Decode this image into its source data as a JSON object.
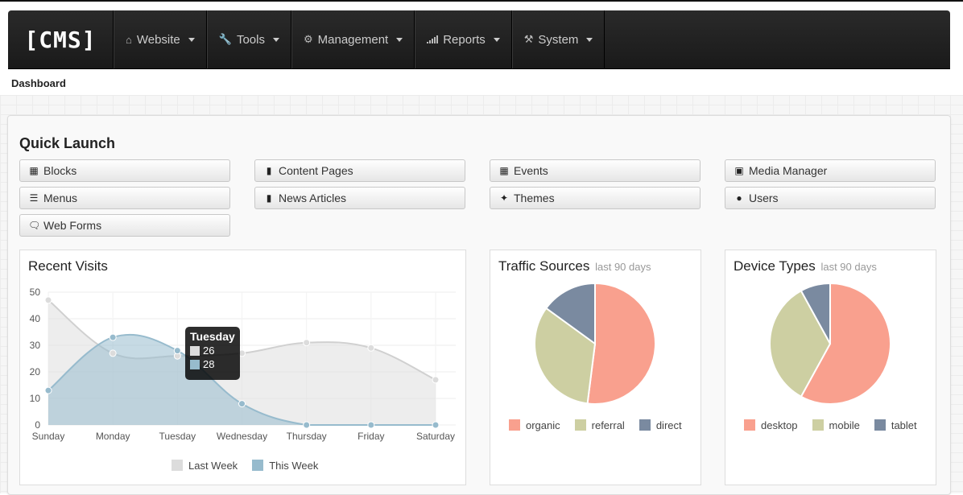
{
  "nav": {
    "brand": "[CMS]",
    "items": [
      {
        "label": "Website",
        "icon": "home-icon"
      },
      {
        "label": "Tools",
        "icon": "wrench-icon"
      },
      {
        "label": "Management",
        "icon": "cogs-icon"
      },
      {
        "label": "Reports",
        "icon": "signal-icon"
      },
      {
        "label": "System",
        "icon": "gavel-icon"
      }
    ]
  },
  "breadcrumb": "Dashboard",
  "quick_launch": {
    "title": "Quick Launch",
    "buttons": [
      {
        "label": "Blocks",
        "icon": "th-large-icon"
      },
      {
        "label": "Content Pages",
        "icon": "file-icon"
      },
      {
        "label": "Events",
        "icon": "calendar-icon"
      },
      {
        "label": "Media Manager",
        "icon": "picture-icon"
      },
      {
        "label": "Menus",
        "icon": "list-icon"
      },
      {
        "label": "News Articles",
        "icon": "book-icon"
      },
      {
        "label": "Themes",
        "icon": "magic-icon"
      },
      {
        "label": "Users",
        "icon": "user-icon"
      },
      {
        "label": "Web Forms",
        "icon": "comments-icon"
      }
    ]
  },
  "recent_visits": {
    "title": "Recent Visits",
    "tooltip": {
      "title": "Tuesday",
      "last_week": "26",
      "this_week": "28"
    }
  },
  "traffic_sources": {
    "title": "Traffic Sources",
    "subtitle": "last 90 days"
  },
  "device_types": {
    "title": "Device Types",
    "subtitle": "last 90 days"
  },
  "colors": {
    "last_week": "#dcdcdc",
    "this_week": "#97bbcd",
    "organic": "#f9a08e",
    "referral": "#cdcfa2",
    "direct": "#7a8aa0"
  },
  "chart_data": [
    {
      "type": "area",
      "title": "Recent Visits",
      "categories": [
        "Sunday",
        "Monday",
        "Tuesday",
        "Wednesday",
        "Thursday",
        "Friday",
        "Saturday"
      ],
      "series": [
        {
          "name": "Last Week",
          "values": [
            47,
            27,
            26,
            27,
            31,
            29,
            17
          ]
        },
        {
          "name": "This Week",
          "values": [
            13,
            33,
            28,
            8,
            0,
            0,
            0
          ]
        }
      ],
      "ylim": [
        0,
        50
      ],
      "yticks": [
        0,
        10,
        20,
        30,
        40,
        50
      ],
      "legend": "bottom"
    },
    {
      "type": "pie",
      "title": "Traffic Sources",
      "subtitle": "last 90 days",
      "slices": [
        {
          "name": "organic",
          "value": 52
        },
        {
          "name": "referral",
          "value": 33
        },
        {
          "name": "direct",
          "value": 15
        }
      ],
      "legend": "bottom"
    },
    {
      "type": "pie",
      "title": "Device Types",
      "subtitle": "last 90 days",
      "slices": [
        {
          "name": "desktop",
          "value": 58
        },
        {
          "name": "mobile",
          "value": 34
        },
        {
          "name": "tablet",
          "value": 8
        }
      ],
      "legend": "bottom"
    }
  ]
}
